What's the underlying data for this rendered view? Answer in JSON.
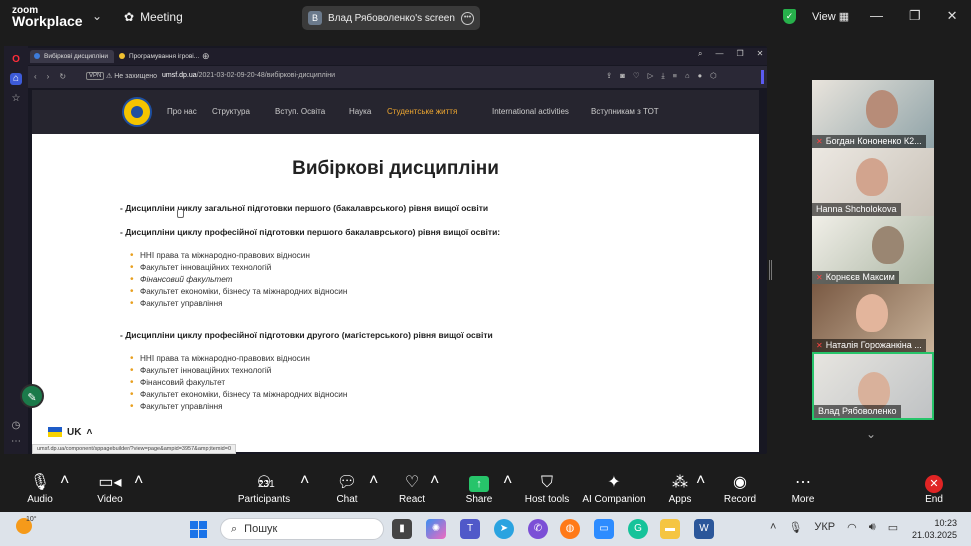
{
  "zoom": {
    "logo_line1": "zoom",
    "logo_line2": "Workplace",
    "meeting_label": "Meeting",
    "share_avatar_letter": "В",
    "share_title": "Влад Рябоволенко's screen",
    "view_label": "View"
  },
  "browser": {
    "tabs": [
      "Вибіркові дисципліни",
      "Програмування ігрові..."
    ],
    "vpn": "VPN",
    "not_secure": "Не захищено",
    "url_host": "umsf.dp.ua",
    "url_path": "/2021-03-02-09-20-48/вибіркові-дисципліни",
    "status_url": "umsf.dp.ua/component/sppagebuilder/?view=page&ampid=3957&amp;itemid=0"
  },
  "site": {
    "menu": [
      "Про нас",
      "Структура",
      "Вступ. Освіта",
      "Наука",
      "Студентське життя",
      "International activities",
      "Вступникам з ТОТ"
    ],
    "active_menu_index": 4,
    "title": "Вибіркові дисципліни",
    "section1": "- Дисципліни циклу загальної підготовки першого (бакалаврського) рівня вищої освіти",
    "section2": "- Дисципліни циклу професійної підготовки першого бакалаврського) рівня вищої освіти:",
    "list1": [
      "ННІ права та міжнародно-правових відносин",
      "Факультет інноваційних технологій",
      "Фінансовий факультет",
      "Факультет економіки, бізнесу та міжнародних відносин",
      "Факультет управління"
    ],
    "section3": "- Дисципліни циклу професійної підготовки другого (магістерського) рівня вищої освіти",
    "list2": [
      "ННІ права та міжнародно-правових відносин",
      "Факультет інноваційних технологій",
      "Фінансовий факультет",
      "Факультет економіки, бізнесу та міжнародних відносин",
      "Факультет управління"
    ],
    "lang": "UK"
  },
  "participants": [
    {
      "name": "Богдан Кононенко К2...",
      "muted": true
    },
    {
      "name": "Hanna Shcholokova",
      "muted": false
    },
    {
      "name": "Корнєєв Максим",
      "muted": true
    },
    {
      "name": "Наталія Горожанкіна ...",
      "muted": true
    },
    {
      "name": "Влад Рябоволенко",
      "muted": false
    }
  ],
  "toolbar": {
    "audio": "Audio",
    "video": "Video",
    "participants": "Participants",
    "participants_count": "231",
    "chat": "Chat",
    "react": "React",
    "share": "Share",
    "host_tools": "Host tools",
    "ai_companion": "AI Companion",
    "apps": "Apps",
    "record": "Record",
    "more": "More",
    "end": "End"
  },
  "taskbar": {
    "weather_temp": "10°",
    "search_placeholder": "Пошук",
    "lang": "УКР",
    "time": "10:23",
    "date": "21.03.2025"
  }
}
